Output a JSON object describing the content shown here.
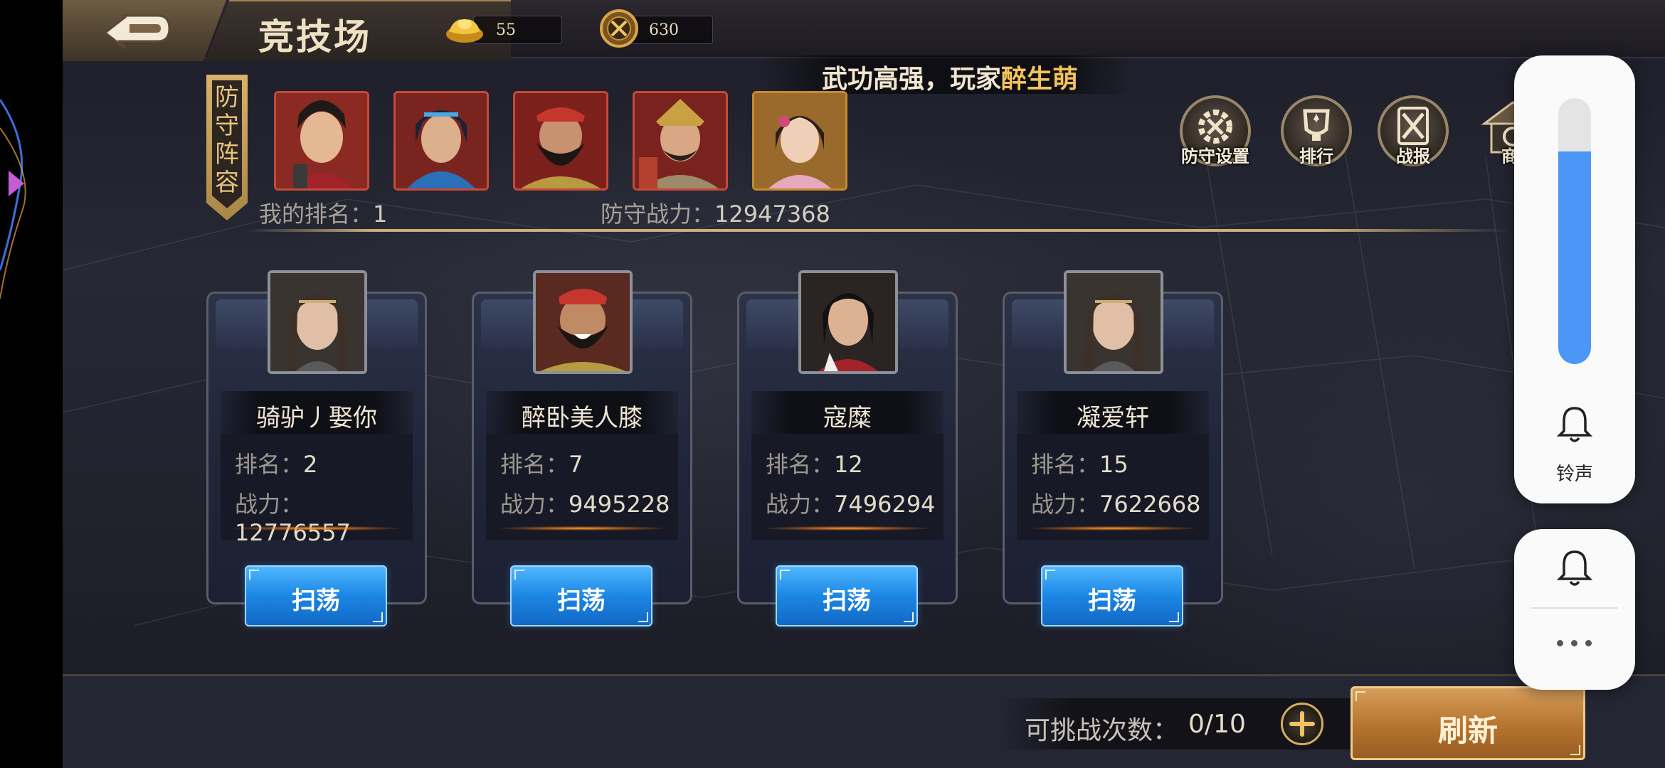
{
  "header": {
    "title": "竞技场",
    "gold_ingot": "55",
    "arena_coin": "630"
  },
  "marquee": {
    "text": "武功高强，玩家",
    "highlight": "醉生萌"
  },
  "defense": {
    "label": "防守阵容",
    "my_rank_label": "我的排名：",
    "my_rank": "1",
    "power_label": "防守战力：",
    "power": "12947368"
  },
  "menu": {
    "defense_settings": "防守设置",
    "ranking": "排行",
    "battle_report": "战报",
    "shop": "商城"
  },
  "opponents": [
    {
      "name": "骑驴丿娶你",
      "rank_label": "排名：",
      "rank": "2",
      "power_label": "战力：",
      "power": "12776557",
      "button": "扫荡"
    },
    {
      "name": "醉卧美人膝",
      "rank_label": "排名：",
      "rank": "7",
      "power_label": "战力：",
      "power": "9495228",
      "button": "扫荡"
    },
    {
      "name": "寇糜",
      "rank_label": "排名：",
      "rank": "12",
      "power_label": "战力：",
      "power": "7496294",
      "button": "扫荡"
    },
    {
      "name": "凝爱轩",
      "rank_label": "排名：",
      "rank": "15",
      "power_label": "战力：",
      "power": "7622668",
      "button": "扫荡"
    }
  ],
  "footer": {
    "challenge_label": "可挑战次数：",
    "challenge_count": "0/10",
    "refresh": "刷新"
  },
  "volume_overlay": {
    "label": "铃声",
    "level": 0.8,
    "accent": "#4a97f8"
  },
  "colors": {
    "sweep_button": "#1c86e4",
    "refresh_button": "#b87730",
    "highlight_text": "#f3c35a"
  },
  "icons": [
    "back-arrow-icon",
    "gold-ingot-icon",
    "arena-coin-icon",
    "gear-icon",
    "trophy-icon",
    "crossed-swords-icon",
    "shop-icon",
    "plus-icon",
    "bell-icon",
    "more-icon"
  ]
}
